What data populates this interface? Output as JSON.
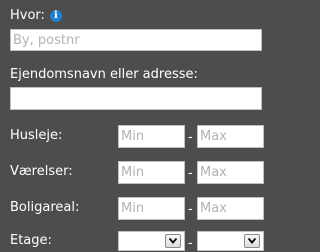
{
  "hvor": {
    "label": "Hvor:",
    "info_icon": "info-icon",
    "placeholder": "By, postnr"
  },
  "ejendom": {
    "label": "Ejendomsnavn eller adresse:",
    "value": ""
  },
  "ranges": [
    {
      "label": "Husleje:",
      "min_placeholder": "Min",
      "max_placeholder": "Max"
    },
    {
      "label": "Værelser:",
      "min_placeholder": "Min",
      "max_placeholder": "Max"
    },
    {
      "label": "Boligareal:",
      "min_placeholder": "Min",
      "max_placeholder": "Max"
    }
  ],
  "separator": "-",
  "etage": {
    "label": "Etage:",
    "separator": "-",
    "min_value": "",
    "max_value": ""
  },
  "colors": {
    "background": "#4d4d4d",
    "info_icon": "#1f7fd0"
  }
}
